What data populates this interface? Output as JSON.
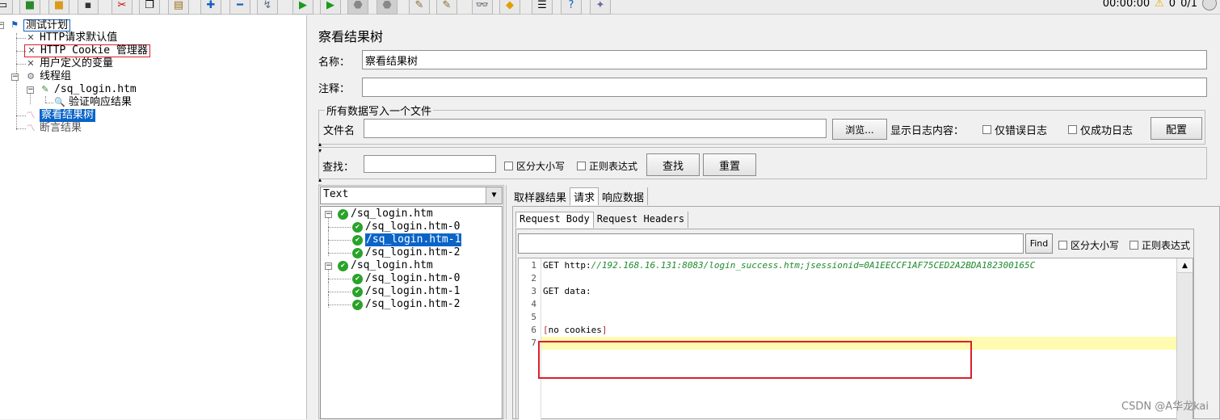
{
  "toolbar": {
    "buttons": [
      "new-icon",
      "templates-icon",
      "open-icon",
      "save-icon",
      "cut-icon",
      "copy-icon",
      "paste-icon",
      "expand-icon",
      "collapse-icon",
      "toggle-icon",
      "start-icon",
      "start-no-pause-icon",
      "stop-icon",
      "shutdown-icon",
      "clear-icon",
      "clear-all-icon",
      "search-icon",
      "reset-search-icon",
      "function-helper-icon",
      "help-icon",
      "remote-icon"
    ],
    "timer": "00:00:00",
    "error_count": "0",
    "thread_count": "0/1"
  },
  "tree": {
    "items": [
      {
        "label": "测试计划",
        "icon": "test-plan-icon"
      },
      {
        "label": "HTTP请求默认值",
        "icon": "config-icon"
      },
      {
        "label": "HTTP Cookie 管理器",
        "icon": "config-icon"
      },
      {
        "label": "用户定义的变量",
        "icon": "config-icon"
      },
      {
        "label": "线程组",
        "icon": "thread-group-icon"
      },
      {
        "label": "/sq_login.htm",
        "icon": "sampler-icon"
      },
      {
        "label": "验证响应结果",
        "icon": "assertion-icon"
      },
      {
        "label": "察看结果树",
        "icon": "listener-icon"
      },
      {
        "label": "断言结果",
        "icon": "listener-icon"
      }
    ]
  },
  "panel": {
    "title": "察看结果树",
    "name_label": "名称：",
    "name_value": "察看结果树",
    "comment_label": "注释：",
    "comment_value": "",
    "file_group_title": "所有数据写入一个文件",
    "file_label": "文件名",
    "file_value": "",
    "browse_label": "浏览...",
    "log_label": "显示日志内容：",
    "errors_only": "仅错误日志",
    "success_only": "仅成功日志",
    "config_label": "配置"
  },
  "search": {
    "label": "查找：",
    "value": "",
    "case_sensitive": "区分大小写",
    "regex": "正则表达式",
    "find_label": "查找",
    "reset_label": "重置"
  },
  "results": {
    "renderer": "Text",
    "items": [
      {
        "label": "/sq_login.htm",
        "level": 0
      },
      {
        "label": "/sq_login.htm-0",
        "level": 1
      },
      {
        "label": "/sq_login.htm-1",
        "level": 1
      },
      {
        "label": "/sq_login.htm-2",
        "level": 1
      },
      {
        "label": "/sq_login.htm",
        "level": 0
      },
      {
        "label": "/sq_login.htm-0",
        "level": 1
      },
      {
        "label": "/sq_login.htm-1",
        "level": 1
      },
      {
        "label": "/sq_login.htm-2",
        "level": 1
      }
    ]
  },
  "detail": {
    "tabs": [
      "取样器结果",
      "请求",
      "响应数据"
    ],
    "subtabs": [
      "Request Body",
      "Request Headers"
    ],
    "find_label": "Find",
    "case_sensitive": "区分大小写",
    "regex": "正则表达式",
    "lines": [
      {
        "n": "1",
        "prefix": "GET http:",
        "link": "//192.168.16.131:8083/login_success.htm;jsessionid=0A1EECCF1AF75CED2A2BDA182300165C"
      },
      {
        "n": "2",
        "prefix": "",
        "link": ""
      },
      {
        "n": "3",
        "prefix": "GET data:",
        "link": ""
      },
      {
        "n": "4",
        "prefix": "",
        "link": ""
      },
      {
        "n": "5",
        "prefix": "",
        "link": ""
      },
      {
        "n": "6",
        "prefix": "[no cookies]",
        "link": ""
      },
      {
        "n": "7",
        "prefix": "",
        "link": ""
      }
    ]
  },
  "watermark": "CSDN @A华龙kai",
  "colors": {
    "selection": "#0a64c8",
    "highlight_line": "#fffbb0",
    "annotation": "#d9202c",
    "link_green": "#1f8a2e"
  }
}
